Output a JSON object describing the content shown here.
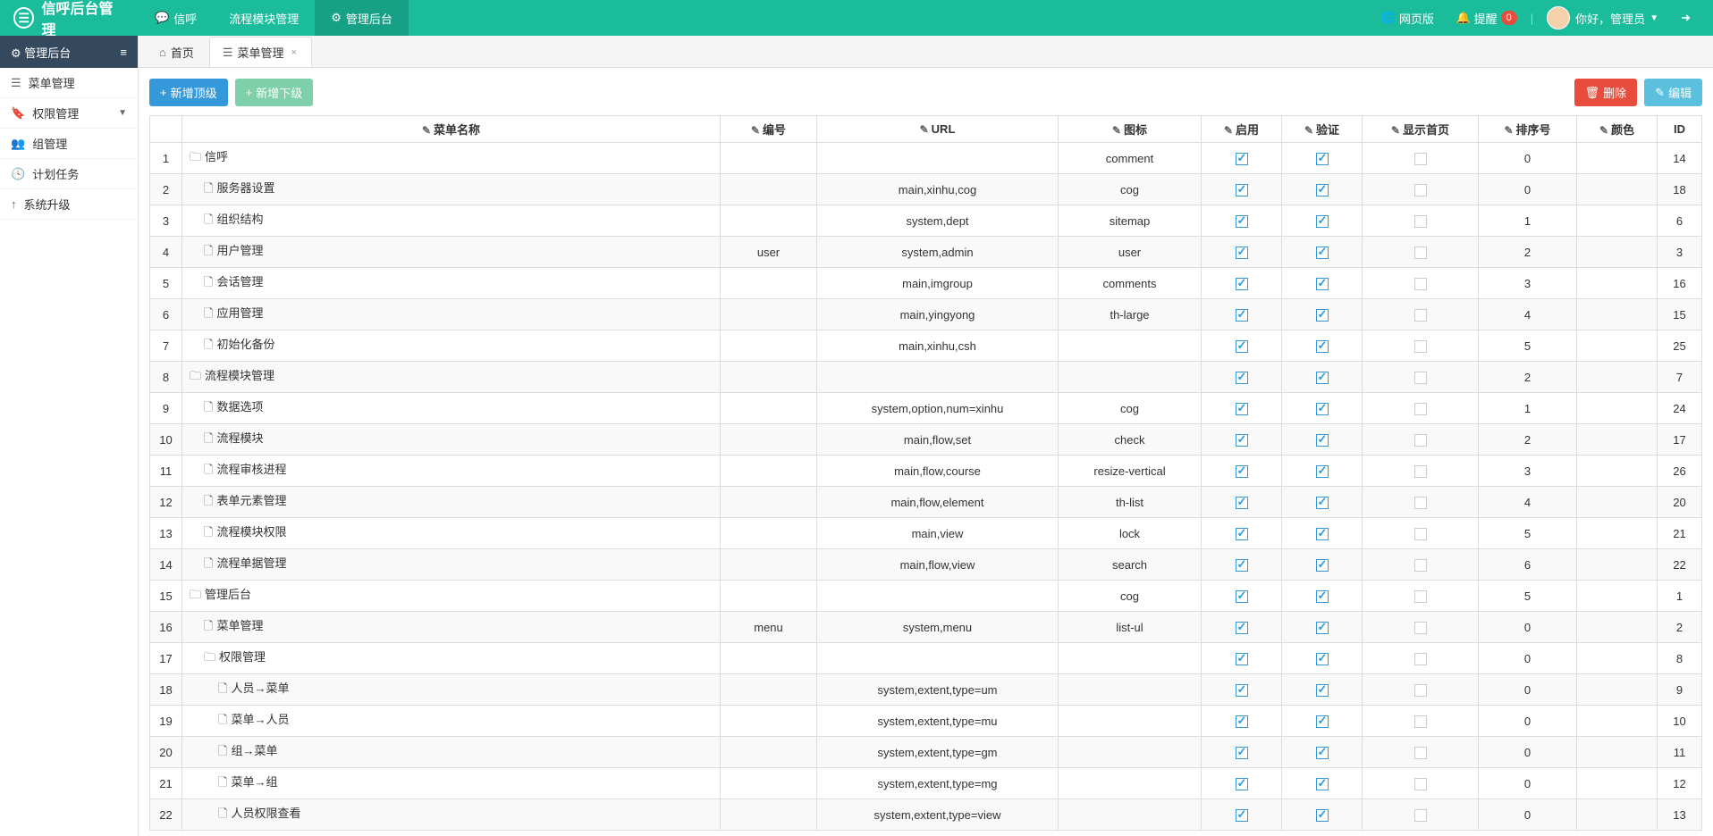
{
  "header": {
    "logo_text": "信呼后台管理",
    "nav": [
      {
        "icon": "💬",
        "label": "信呼",
        "active": false
      },
      {
        "icon": "",
        "label": "流程模块管理",
        "active": false
      },
      {
        "icon": "⚙",
        "label": "管理后台",
        "active": true
      }
    ],
    "right": {
      "web_label": "网页版",
      "remind_label": "提醒",
      "remind_count": "0",
      "greet": "你好，管理员"
    }
  },
  "sidebar": {
    "title": "管理后台",
    "items": [
      {
        "icon": "☰",
        "label": "菜单管理"
      },
      {
        "icon": "🔖",
        "label": "权限管理",
        "caret": true
      },
      {
        "icon": "👥",
        "label": "组管理"
      },
      {
        "icon": "🕓",
        "label": "计划任务"
      },
      {
        "icon": "↑",
        "label": "系统升级"
      }
    ]
  },
  "tabs": [
    {
      "icon": "⌂",
      "label": "首页",
      "active": false,
      "closable": false
    },
    {
      "icon": "☰",
      "label": "菜单管理",
      "active": true,
      "closable": true
    }
  ],
  "toolbar": {
    "add_top": "新增顶级",
    "add_sub": "新增下级",
    "delete": "删除",
    "edit": "编辑"
  },
  "table": {
    "headers": {
      "name": "菜单名称",
      "code": "编号",
      "url": "URL",
      "icon": "图标",
      "enable": "启用",
      "verify": "验证",
      "home": "显示首页",
      "sort": "排序号",
      "color": "颜色",
      "id": "ID"
    },
    "rows": [
      {
        "n": 1,
        "lvl": 0,
        "f": true,
        "name": "信呼",
        "code": "",
        "url": "",
        "icon": "comment",
        "en": true,
        "ve": true,
        "ho": false,
        "sort": "0",
        "id": "14"
      },
      {
        "n": 2,
        "lvl": 1,
        "f": false,
        "name": "服务器设置",
        "code": "",
        "url": "main,xinhu,cog",
        "icon": "cog",
        "en": true,
        "ve": true,
        "ho": false,
        "sort": "0",
        "id": "18"
      },
      {
        "n": 3,
        "lvl": 1,
        "f": false,
        "name": "组织结构",
        "code": "",
        "url": "system,dept",
        "icon": "sitemap",
        "en": true,
        "ve": true,
        "ho": false,
        "sort": "1",
        "id": "6"
      },
      {
        "n": 4,
        "lvl": 1,
        "f": false,
        "name": "用户管理",
        "code": "user",
        "url": "system,admin",
        "icon": "user",
        "en": true,
        "ve": true,
        "ho": false,
        "sort": "2",
        "id": "3"
      },
      {
        "n": 5,
        "lvl": 1,
        "f": false,
        "name": "会话管理",
        "code": "",
        "url": "main,imgroup",
        "icon": "comments",
        "en": true,
        "ve": true,
        "ho": false,
        "sort": "3",
        "id": "16"
      },
      {
        "n": 6,
        "lvl": 1,
        "f": false,
        "name": "应用管理",
        "code": "",
        "url": "main,yingyong",
        "icon": "th-large",
        "en": true,
        "ve": true,
        "ho": false,
        "sort": "4",
        "id": "15"
      },
      {
        "n": 7,
        "lvl": 1,
        "f": false,
        "name": "初始化备份",
        "code": "",
        "url": "main,xinhu,csh",
        "icon": "",
        "en": true,
        "ve": true,
        "ho": false,
        "sort": "5",
        "id": "25"
      },
      {
        "n": 8,
        "lvl": 0,
        "f": true,
        "name": "流程模块管理",
        "code": "",
        "url": "",
        "icon": "",
        "en": true,
        "ve": true,
        "ho": false,
        "sort": "2",
        "id": "7"
      },
      {
        "n": 9,
        "lvl": 1,
        "f": false,
        "name": "数据选项",
        "code": "",
        "url": "system,option,num=xinhu",
        "icon": "cog",
        "en": true,
        "ve": true,
        "ho": false,
        "sort": "1",
        "id": "24"
      },
      {
        "n": 10,
        "lvl": 1,
        "f": false,
        "name": "流程模块",
        "code": "",
        "url": "main,flow,set",
        "icon": "check",
        "en": true,
        "ve": true,
        "ho": false,
        "sort": "2",
        "id": "17"
      },
      {
        "n": 11,
        "lvl": 1,
        "f": false,
        "name": "流程审核进程",
        "code": "",
        "url": "main,flow,course",
        "icon": "resize-vertical",
        "en": true,
        "ve": true,
        "ho": false,
        "sort": "3",
        "id": "26"
      },
      {
        "n": 12,
        "lvl": 1,
        "f": false,
        "name": "表单元素管理",
        "code": "",
        "url": "main,flow,element",
        "icon": "th-list",
        "en": true,
        "ve": true,
        "ho": false,
        "sort": "4",
        "id": "20"
      },
      {
        "n": 13,
        "lvl": 1,
        "f": false,
        "name": "流程模块权限",
        "code": "",
        "url": "main,view",
        "icon": "lock",
        "en": true,
        "ve": true,
        "ho": false,
        "sort": "5",
        "id": "21"
      },
      {
        "n": 14,
        "lvl": 1,
        "f": false,
        "name": "流程单据管理",
        "code": "",
        "url": "main,flow,view",
        "icon": "search",
        "en": true,
        "ve": true,
        "ho": false,
        "sort": "6",
        "id": "22"
      },
      {
        "n": 15,
        "lvl": 0,
        "f": true,
        "name": "管理后台",
        "code": "",
        "url": "",
        "icon": "cog",
        "en": true,
        "ve": true,
        "ho": false,
        "sort": "5",
        "id": "1"
      },
      {
        "n": 16,
        "lvl": 1,
        "f": false,
        "name": "菜单管理",
        "code": "menu",
        "url": "system,menu",
        "icon": "list-ul",
        "en": true,
        "ve": true,
        "ho": false,
        "sort": "0",
        "id": "2"
      },
      {
        "n": 17,
        "lvl": 1,
        "f": true,
        "name": "权限管理",
        "code": "",
        "url": "",
        "icon": "",
        "en": true,
        "ve": true,
        "ho": false,
        "sort": "0",
        "id": "8"
      },
      {
        "n": 18,
        "lvl": 2,
        "f": false,
        "name": "人员→菜单",
        "code": "",
        "url": "system,extent,type=um",
        "icon": "",
        "en": true,
        "ve": true,
        "ho": false,
        "sort": "0",
        "id": "9"
      },
      {
        "n": 19,
        "lvl": 2,
        "f": false,
        "name": "菜单→人员",
        "code": "",
        "url": "system,extent,type=mu",
        "icon": "",
        "en": true,
        "ve": true,
        "ho": false,
        "sort": "0",
        "id": "10"
      },
      {
        "n": 20,
        "lvl": 2,
        "f": false,
        "name": "组→菜单",
        "code": "",
        "url": "system,extent,type=gm",
        "icon": "",
        "en": true,
        "ve": true,
        "ho": false,
        "sort": "0",
        "id": "11"
      },
      {
        "n": 21,
        "lvl": 2,
        "f": false,
        "name": "菜单→组",
        "code": "",
        "url": "system,extent,type=mg",
        "icon": "",
        "en": true,
        "ve": true,
        "ho": false,
        "sort": "0",
        "id": "12"
      },
      {
        "n": 22,
        "lvl": 2,
        "f": false,
        "name": "人员权限查看",
        "code": "",
        "url": "system,extent,type=view",
        "icon": "",
        "en": true,
        "ve": true,
        "ho": false,
        "sort": "0",
        "id": "13"
      }
    ]
  }
}
